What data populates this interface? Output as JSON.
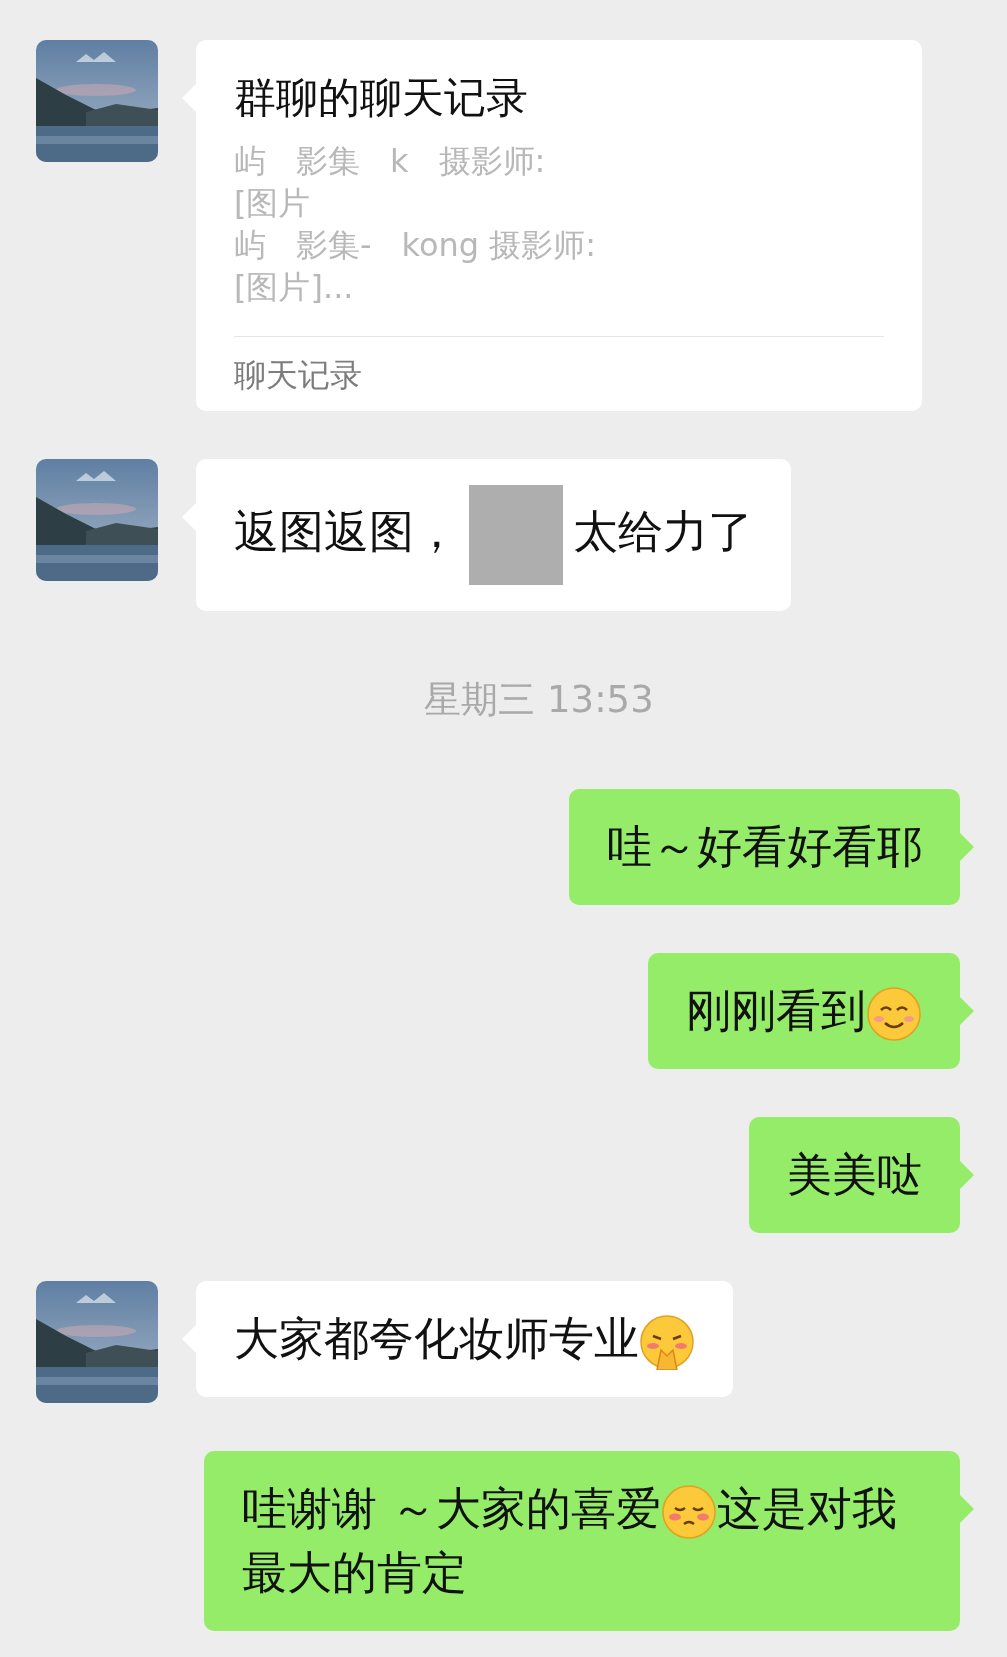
{
  "messages": [
    {
      "kind": "record",
      "outgoing": false,
      "title": "群聊的聊天记录",
      "lines": [
        [
          "屿",
          "影集",
          "k",
          "摄影师:"
        ],
        [
          "[图片"
        ],
        [
          "屿",
          "影集-",
          "kong 摄影师:"
        ],
        [
          "[图片]..."
        ]
      ],
      "footer": "聊天记录"
    },
    {
      "kind": "text",
      "outgoing": false,
      "segments": [
        {
          "kind": "text",
          "text": "返图返图，"
        },
        {
          "kind": "redacted"
        },
        {
          "kind": "text",
          "text": "太给力了"
        }
      ]
    },
    {
      "kind": "time",
      "text": "星期三 13:53"
    },
    {
      "kind": "text",
      "outgoing": true,
      "segments": [
        {
          "kind": "text",
          "text": "哇～好看好看耶"
        }
      ]
    },
    {
      "kind": "text",
      "outgoing": true,
      "segments": [
        {
          "kind": "text",
          "text": "刚刚看到"
        },
        {
          "kind": "smile"
        }
      ]
    },
    {
      "kind": "text",
      "outgoing": true,
      "segments": [
        {
          "kind": "text",
          "text": "美美哒"
        }
      ]
    },
    {
      "kind": "text",
      "outgoing": false,
      "segments": [
        {
          "kind": "text",
          "text": "大家都夸化妆师专业"
        },
        {
          "kind": "shy"
        }
      ]
    },
    {
      "kind": "text",
      "outgoing": true,
      "segments": [
        {
          "kind": "text",
          "text": "哇谢谢 ～大家的喜爱"
        },
        {
          "kind": "bashful"
        },
        {
          "kind": "text",
          "text": "这是对我最大的肯定"
        }
      ]
    }
  ]
}
